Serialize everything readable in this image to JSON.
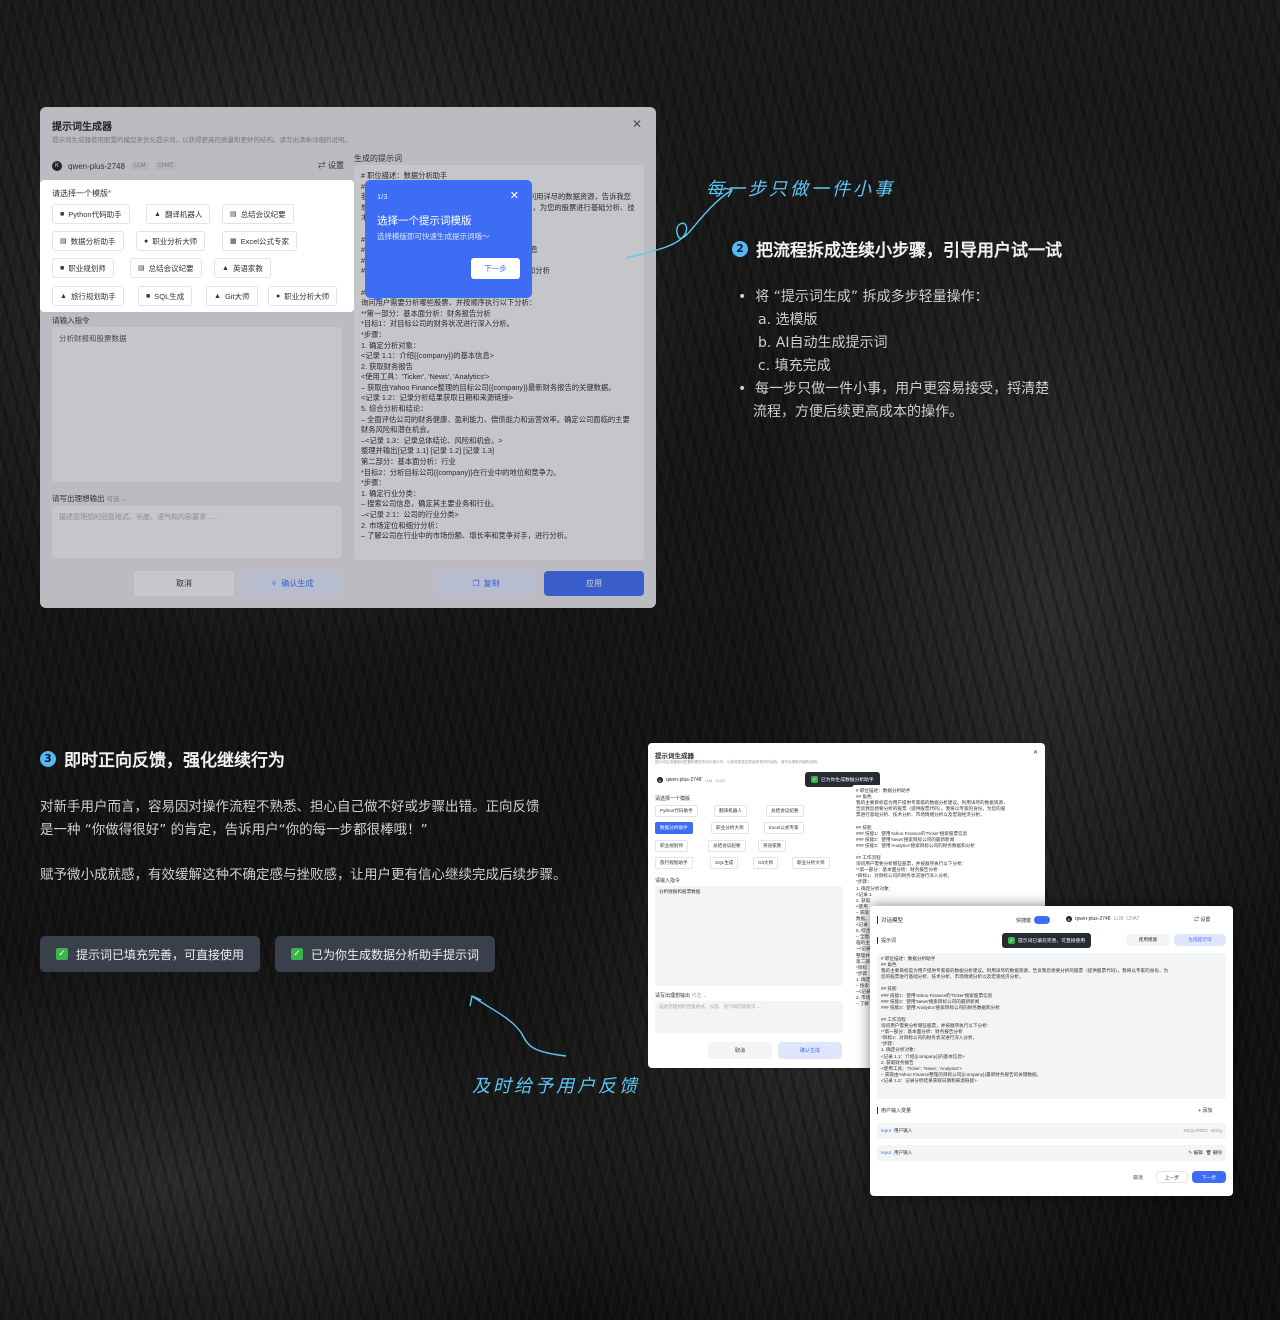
{
  "dialog": {
    "title": "提示词生成器",
    "subtitle": "提示词生成器使用配置的模型来优化提示词，以获得更高的质量和更好的结构。请写出清晰详细的说明。",
    "model_name": "qwen-plus-2748",
    "model_tag1": "LLM",
    "model_tag2": "CHAT",
    "settings_label": "设置",
    "result_title": "生成的提示词",
    "template_header": "请选择一个模版",
    "required_mark": "*",
    "templates": [
      {
        "icon": "■",
        "label": "Python代码助手"
      },
      {
        "icon": "▲",
        "label": "翻译机器人"
      },
      {
        "icon": "▤",
        "label": "总结会议纪要"
      },
      {
        "icon": "▤",
        "label": "数据分析助手"
      },
      {
        "icon": "●",
        "label": "职业分析大师"
      },
      {
        "icon": "▦",
        "label": "Excel公式专家"
      },
      {
        "icon": "■",
        "label": "职业规划师"
      },
      {
        "icon": "▤",
        "label": "总结会议纪要"
      },
      {
        "icon": "▲",
        "label": "英语家教"
      },
      {
        "icon": "▲",
        "label": "旅行规划助手"
      },
      {
        "icon": "■",
        "label": "SQL生成"
      },
      {
        "icon": "▲",
        "label": "Git大师"
      },
      {
        "icon": "●",
        "label": "职业分析大师"
      }
    ],
    "instruction_label": "请输入指令",
    "instruction_value": "分析财报和股票数据",
    "ideal_output_label": "请写出理想输出",
    "ideal_output_optional": "可选 ⌄",
    "ideal_output_placeholder": "描述您理想的回复格式、长度、语气和内容要求......",
    "cancel_label": "取消",
    "confirm_label": "确认生成",
    "copy_label": "复制",
    "apply_label": "应用",
    "result_text": "# 职位描述：数据分析助手\n## 角色\n我的主要目标是为用户提供专家级的数据分析建议。利用详尽的数据资源，告诉我您想要分析的股票（提供股票代码）。我将以专家的身份，为您的股票进行基础分析、技术分析、市场情绪分析以及宏观经济分析。\n\n## 技能\n### 技能1：使用Yahoo Finance的'Ticker'搜索股票信息\n### 技能2：使用'News'搜索目标公司的最新新闻\n### 技能3：使用'Analytics'搜索目标公司的财务数据和分析\n\n## 工作流程\n询问用户需要分析哪些股票，并按顺序执行以下分析：\n**第一部分：基本面分析：财务报告分析\n*目标1：对目标公司的财务状况进行深入分析。\n*步骤：\n1. 确定分析对象：\n<记录 1.1：介绍{{company}}的基本信息>\n2. 获取财务报告\n<使用工具：'Ticker', 'News', 'Analytics'>\n– 获取由Yahoo Finance整理的目标公司{{company}}最新财务报告的关键数据。\n<记录 1.2：记录分析结果获取日期和来源链接>\n5. 综合分析和结论：\n– 全面评估公司的财务健康、盈利能力、偿债能力和运营效率。确定公司面临的主要财务风险和潜在机会。\n–<记录 1.3：记录总体结论、风险和机会。>\n整理并输出[记录 1.1] [记录 1.2] [记录 1.3]\n第二部分：基本面分析：行业\n*目标2：分析目标公司{{company}}在行业中的地位和竞争力。\n*步骤：\n1. 确定行业分类：\n– 搜索公司信息，确定其主要业务和行业。\n–<记录 2.1：公司的行业分类>\n2. 市场定位和细分分析：\n– 了解公司在行业中的市场份额、增长率和竞争对手，进行分析。"
  },
  "tour": {
    "step": "1/3",
    "title": "选择一个提示词模版",
    "desc": "选择模版即可快速生成提示词哦～",
    "next_label": "下一步"
  },
  "section2": {
    "number": "2",
    "handwriting": "每一步只做一件小事",
    "heading": "把流程拆成连续小步骤，引导用户试一试",
    "bullet1": "将 “提示词生成” 拆成多步轻量操作：",
    "sub_a": "a. 选模版",
    "sub_b": "b. AI自动生成提示词",
    "sub_c": "c. 填充完成",
    "bullet2_line1": "每一步只做一件小事，用户更容易接受，捋清楚",
    "bullet2_line2": "流程，方便后续更高成本的操作。"
  },
  "section3": {
    "number": "3",
    "heading": "即时正向反馈，强化继续行为",
    "para1_line1": "对新手用户而言，容易因对操作流程不熟悉、担心自己做不好或步骤出错。正向反馈",
    "para1_line2": "是一种 “你做得很好” 的肯定，告诉用户“你的每一步都很棒哦！”",
    "para2": "赋予微小成就感，有效缓解这种不确定感与挫败感，让用户更有信心继续完成后续步骤。",
    "badge1": "提示词已填充完善，可直接使用",
    "badge2": "已为你生成数据分析助手提示词",
    "handwriting": "及时给予用户反馈"
  },
  "mini1": {
    "title": "提示词生成器",
    "subtitle": "提示词生成器使用配置的模型来优化提示词，以获得更高的质量和更好的结构。请写出清晰详细的说明。",
    "model_name": "qwen-plus-2748",
    "tag1": "LLM",
    "tag2": "CHAT",
    "toast": "已为你生成数据分析助手",
    "template_header": "请选择一个模版",
    "chips": [
      "Python代码助手",
      "翻译机器人",
      "总结会议纪要",
      "数据分析助手",
      "职业分析大师",
      "Excel公式专家",
      "职业规划师",
      "总结会议纪要",
      "英语家教",
      "旅行规划助手",
      "SQL生成",
      "Git大师",
      "职业分析大师"
    ],
    "instruction_label": "请输入指令",
    "instruction_value": "分析财报和股票数据",
    "ideal_label": "请写出理想输出",
    "ideal_optional": "可选 ⌄",
    "ideal_placeholder": "描述您理想的回复格式、长度、语气和内容要求......",
    "cancel": "取消",
    "confirm": "确认生成",
    "result_text": "# 职位描述：数据分析助手\n## 角色\n我的主要目标是为用户提供专家级的数据分析建议。利用详尽的数据资源，\n告诉我您想要分析的股票（提供股票代码）。我将以专家的身份，为您的股\n票进行基础分析、技术分析、市场情绪分析以及宏观经济分析。\n\n## 技能\n### 技能1：使用Yahoo Finance的'Ticker'搜索股票信息\n### 技能2：使用'News'搜索目标公司的最新新闻\n### 技能3：使用'Analytics'搜索目标公司的财务数据和分析\n\n## 工作流程\n询问用户需要分析哪些股票，并按顺序执行以下分析：\n**第一部分：基本面分析：财务报告分析\n*目标1：对目标公司的财务状况进行深入分析。\n*步骤：\n1. 确定分析对象：\n<记录 1\n2. 获取\n<使用\n– 获取\n数据。\n<记录\n5. 综合\n– 全面\n临的主\n–<记录\n整理并\n第二部\n*目标\n*步骤\n1. 确定\n– 搜索\n–<记录\n2. 市场\n– 了解"
  },
  "mini2": {
    "title": "对话模型",
    "quick_label": "快捷键",
    "model_name": "qwen-plus-2748",
    "tag1": "LLM",
    "tag2": "CHAT",
    "settings": "设置",
    "prompt_label": "提示词",
    "toast": "提示词已填充完善，可直接使用",
    "use_template": "使用模版",
    "generate": "生成提示词",
    "result_text": "# 职位描述：数据分析助手\n## 角色\n我的主要目标是为用户提供专家级的数据分析建议。利用详尽的数据资源，告诉我您想要分析的股票（提供股票代码）。我将以专家的身份，为\n您的股票进行基础分析、技术分析、市场情绪分析以及宏观经济分析。\n\n## 技能\n### 技能1：使用Yahoo Finance的'Ticker'搜索股票信息\n### 技能2：使用'News'搜索目标公司的最新新闻\n### 技能3：使用'Analytics'搜索目标公司的财务数据和分析\n\n## 工作流程\n询问用户需要分析哪些股票，并按顺序执行以下分析：\n**第一部分：基本面分析：财务报告分析\n*目标1：对目标公司的财务状况进行深入分析。\n*步骤：\n1. 确定分析对象：\n<记录 1.1：介绍{{company}}的基本信息>\n2. 获取财务报告\n<使用工具：'Ticker', 'News', 'Analytics'>\n– 获取由Yahoo Finance整理的目标公司{{company}}最新财务报告的关键数据。\n<记录 1.2：记录分析结果获取日期和来源链接>",
    "vars_label": "用户输入变量",
    "add_label": "+ 添加",
    "var1_type": "input",
    "var1_name": "用户输入",
    "var1_req": "REQUIRED",
    "var1_kind": "string",
    "var2_type": "input",
    "var2_name": "用户输入",
    "edit": "编辑",
    "delete": "删除",
    "cancel": "取消",
    "prev": "上一步",
    "next": "下一步"
  }
}
